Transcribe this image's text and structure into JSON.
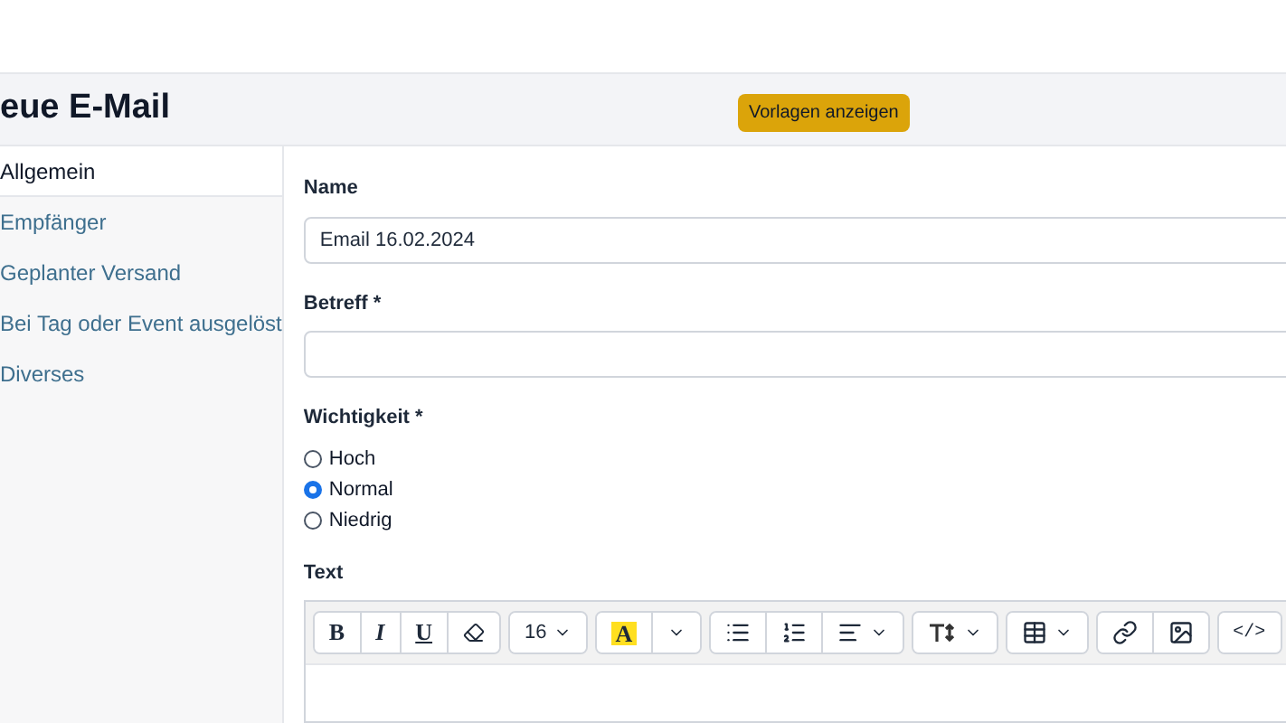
{
  "header": {
    "title": "eue E-Mail",
    "button": "Vorlagen anzeigen"
  },
  "sidebar": {
    "items": [
      {
        "label": "Allgemein",
        "selected": true
      },
      {
        "label": "Empfänger",
        "selected": false
      },
      {
        "label": "Geplanter Versand",
        "selected": false
      },
      {
        "label": "Bei Tag oder Event ausgelöst",
        "selected": false
      },
      {
        "label": "Diverses",
        "selected": false
      }
    ]
  },
  "form": {
    "name": {
      "label": "Name",
      "value": "Email 16.02.2024"
    },
    "subject": {
      "label": "Betreff *"
    },
    "priority": {
      "label": "Wichtigkeit *",
      "options": [
        {
          "label": "Hoch",
          "selected": false
        },
        {
          "label": "Normal",
          "selected": true
        },
        {
          "label": "Niedrig",
          "selected": false
        }
      ]
    },
    "text": {
      "label": "Text",
      "toolbar": [
        [
          {
            "kind": "bold",
            "label": "B"
          },
          {
            "kind": "italic",
            "label": "I"
          },
          {
            "kind": "underline",
            "label": "U"
          },
          {
            "kind": "eraser"
          }
        ],
        [
          {
            "kind": "dropdown",
            "label": "16"
          }
        ],
        [
          {
            "kind": "highlight",
            "label": "A"
          },
          {
            "kind": "caret"
          }
        ],
        [
          {
            "kind": "ul"
          },
          {
            "kind": "ol"
          },
          {
            "kind": "align"
          }
        ],
        [
          {
            "kind": "height"
          }
        ],
        [
          {
            "kind": "table"
          }
        ],
        [
          {
            "kind": "link"
          },
          {
            "kind": "image"
          }
        ],
        [
          {
            "kind": "code",
            "label": "</>"
          }
        ]
      ]
    }
  }
}
